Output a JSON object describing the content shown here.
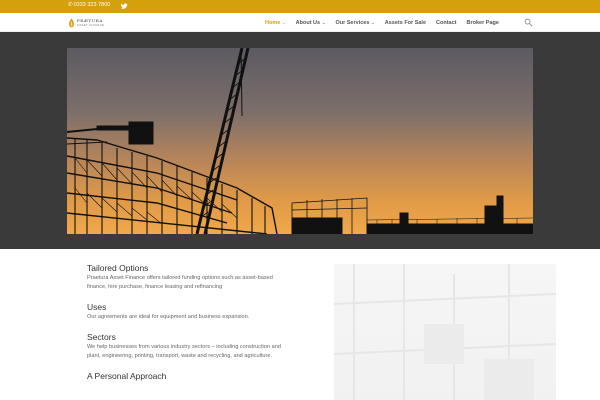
{
  "topbar": {
    "phone": "0333 323 7800",
    "accent_color": "#d4a00c",
    "social_icon": "twitter-icon"
  },
  "header": {
    "logo": {
      "line1": "PRÆTURA",
      "line2": "ASSET FINANCE"
    },
    "nav": [
      {
        "label": "Home",
        "has_dropdown": true,
        "active": true
      },
      {
        "label": "About Us",
        "has_dropdown": true,
        "active": false
      },
      {
        "label": "Our Services",
        "has_dropdown": true,
        "active": false
      },
      {
        "label": "Assets For Sale",
        "has_dropdown": false,
        "active": false
      },
      {
        "label": "Contact",
        "has_dropdown": false,
        "active": false
      },
      {
        "label": "Broker Page",
        "has_dropdown": false,
        "active": false
      }
    ],
    "search_icon": "search-icon"
  },
  "content": {
    "sections": [
      {
        "heading": "Tailored Options",
        "body": "Praetura Asset Finance offers tailored funding options such as asset-based finance, hire purchase, finance leasing and refinancing"
      },
      {
        "heading": "Uses",
        "body": "Our agreements are ideal for equipment and business expansion."
      },
      {
        "heading": "Sectors",
        "body": "We help businesses from various industry sectors – including construction and plant, engineering, printing, transport, waste and recycling, and agriculture."
      },
      {
        "heading": "A Personal Approach",
        "body": ""
      }
    ]
  }
}
